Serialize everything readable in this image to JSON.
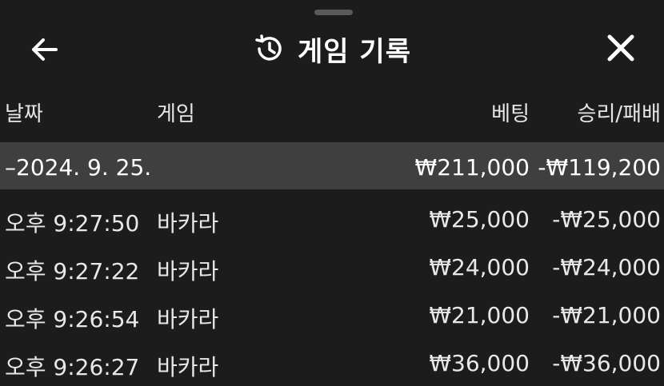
{
  "header": {
    "title": "게임 기록",
    "back_icon": "arrow-left-icon",
    "history_icon": "history-clock-icon",
    "close_icon": "close-x-icon"
  },
  "columns": {
    "date": "날짜",
    "game": "게임",
    "bet": "베팅",
    "result": "승리/패배"
  },
  "group": {
    "date": "–2024. 9. 25.",
    "bet": "₩211,000",
    "result": "-₩119,200"
  },
  "rows": [
    {
      "time": "오후 9:27:50",
      "game": "바카라",
      "bet": "₩25,000",
      "result": "-₩25,000"
    },
    {
      "time": "오후 9:27:22",
      "game": "바카라",
      "bet": "₩24,000",
      "result": "-₩24,000"
    },
    {
      "time": "오후 9:26:54",
      "game": "바카라",
      "bet": "₩21,000",
      "result": "-₩21,000"
    },
    {
      "time": "오후 9:26:27",
      "game": "바카라",
      "bet": "₩36,000",
      "result": "-₩36,000"
    }
  ],
  "colors": {
    "background": "#1c1c1c",
    "group_row": "#3f3f3f",
    "text": "#ffffff"
  }
}
